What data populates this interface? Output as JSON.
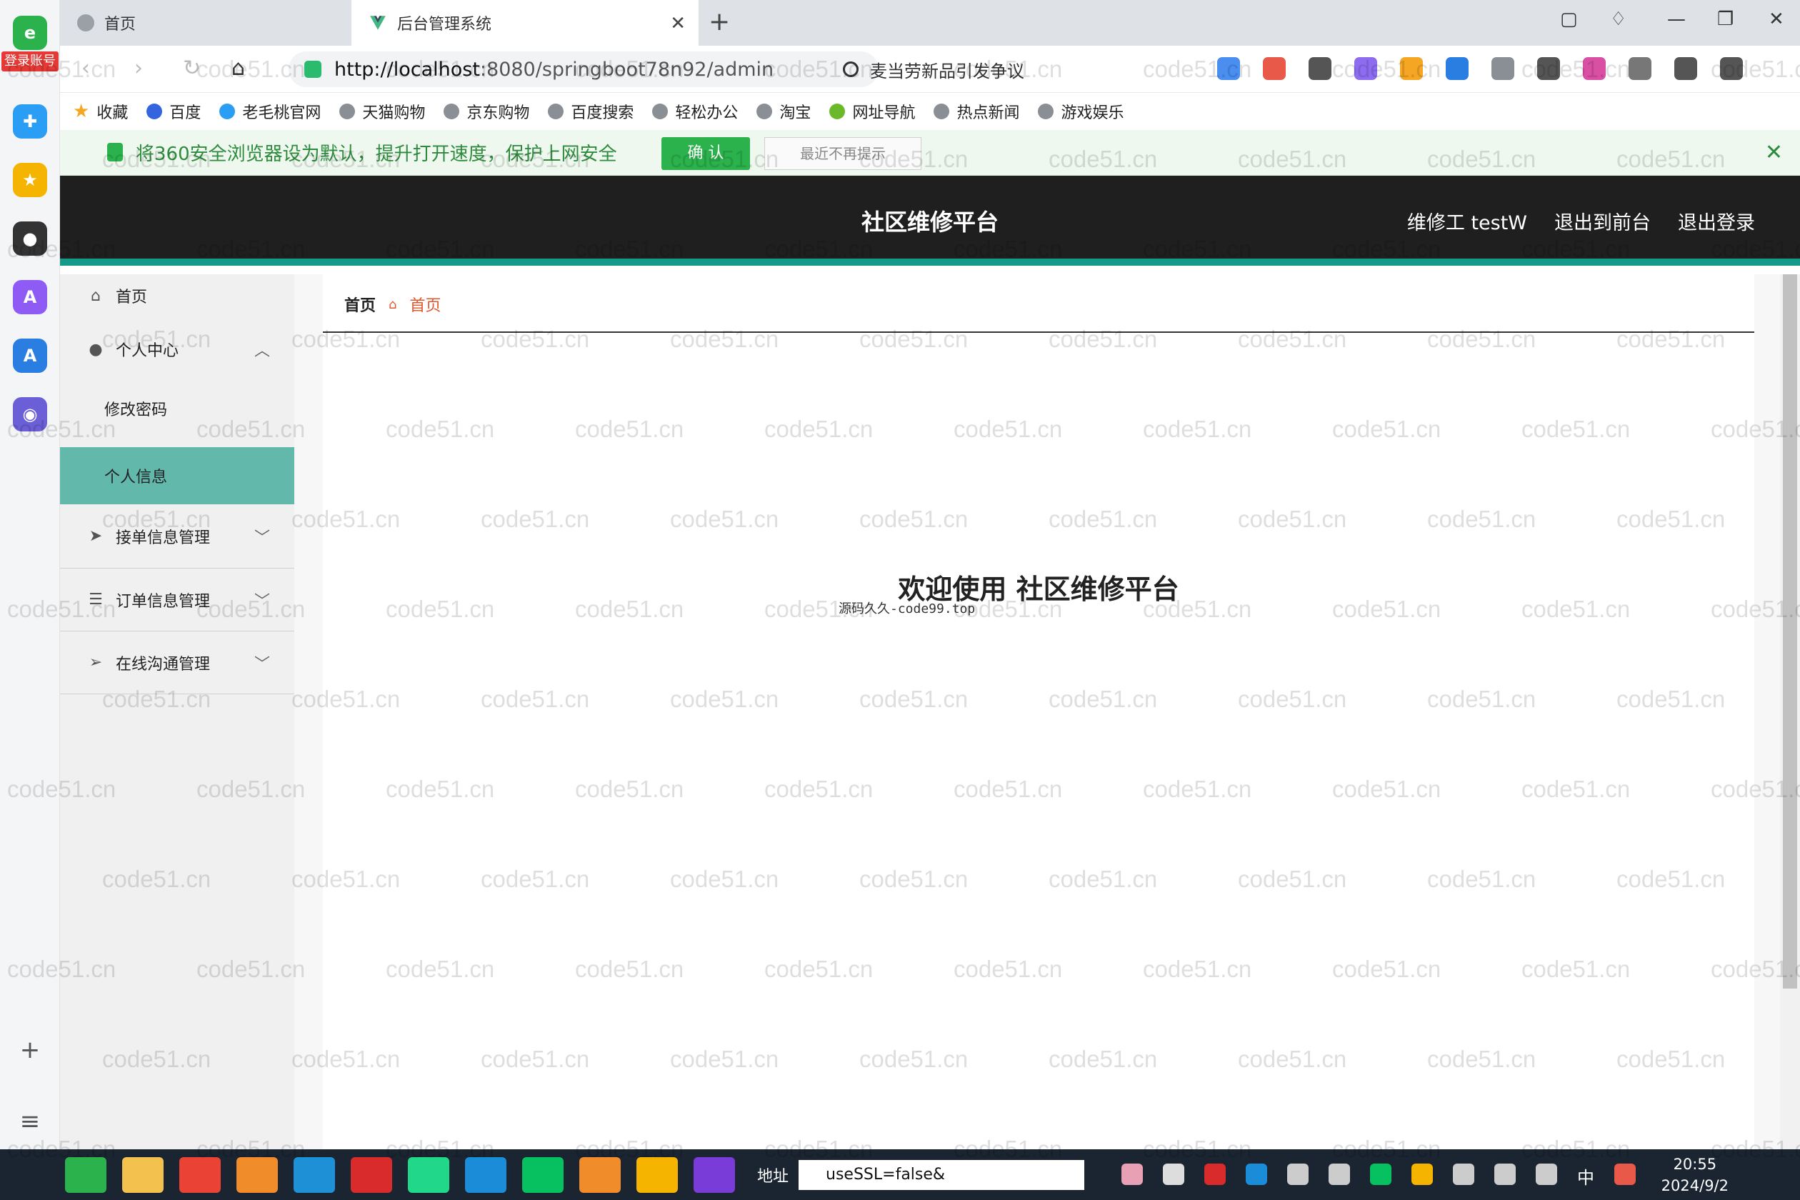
{
  "browser": {
    "login_badge": "登录账号",
    "tabs": [
      {
        "label": "首页",
        "active": false
      },
      {
        "label": "后台管理系统",
        "active": true
      }
    ],
    "new_tab": "+",
    "url_host": "http://localhost",
    "url_path": ":8080/springboot78n92/admin",
    "search_text": "麦当劳新品引发争议",
    "bookmarks": [
      "收藏",
      "百度",
      "老毛桃官网",
      "天猫购物",
      "京东购物",
      "百度搜索",
      "轻松办公",
      "淘宝",
      "网址导航",
      "热点新闻",
      "游戏娱乐"
    ],
    "notice": {
      "text": "将360安全浏览器设为默认，提升打开速度，保护上网安全",
      "confirm": "确 认",
      "dismiss": "最近不再提示"
    }
  },
  "header": {
    "title": "社区维修平台",
    "user": "维修工 testW",
    "front": "退出到前台",
    "logout": "退出登录"
  },
  "sidebar": {
    "home": "首页",
    "personal_center": "个人中心",
    "change_password": "修改密码",
    "personal_info": "个人信息",
    "order_accept": "接单信息管理",
    "order_info": "订单信息管理",
    "online_chat": "在线沟通管理"
  },
  "breadcrumb": {
    "root": "首页",
    "current": "首页"
  },
  "main": {
    "welcome": "欢迎使用 社区维修平台",
    "source_note": "源码久久-code99.top"
  },
  "taskbar": {
    "address_label": "地址",
    "address_value": "useSSL=false&",
    "ime": "中",
    "time": "20:55",
    "date": "2024/9/2"
  },
  "watermark": "code51.cn",
  "colors": {
    "header_bg": "#1f1f1f",
    "accent_teal": "#169b8a",
    "active_menu": "#63b8ac",
    "breadcrumb_orange": "#e2572b",
    "notice_green": "#2bb24c"
  }
}
